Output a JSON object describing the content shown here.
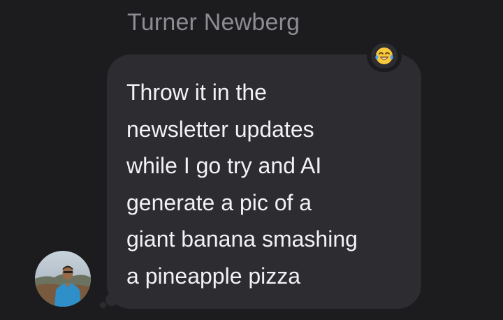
{
  "conversation": {
    "sender_name": "Turner Newberg",
    "message_lines": [
      "Throw it in the",
      "newsletter updates",
      "while I go try and AI",
      "generate a pic of a",
      "giant banana smashing",
      "a pineapple pizza"
    ],
    "reaction": {
      "icon": "tears-of-joy-emoji-icon"
    },
    "avatar": {
      "icon": "person-avatar"
    }
  },
  "colors": {
    "background": "#1c1c1f",
    "bubble": "#2c2c31",
    "sender_text": "#8c8c92",
    "message_text": "#f2f2f4"
  }
}
